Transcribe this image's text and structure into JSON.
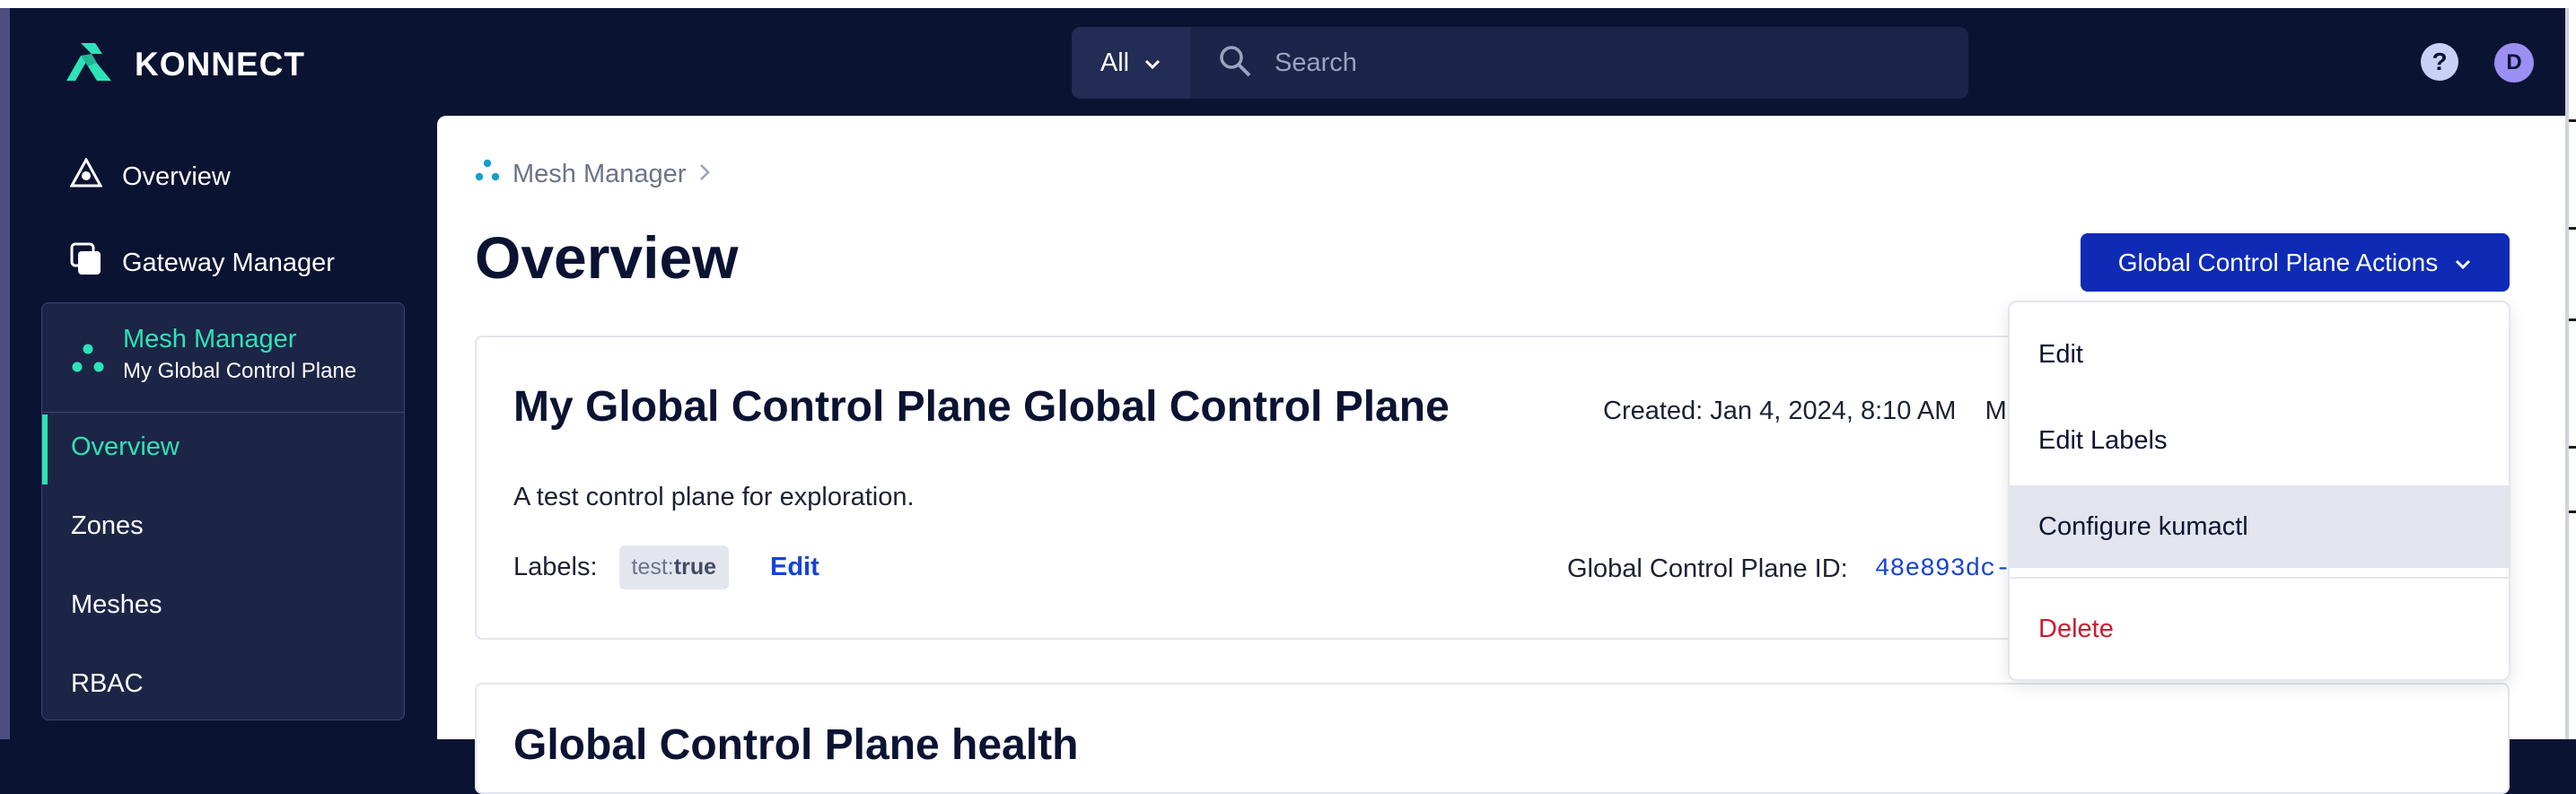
{
  "brand": {
    "name": "KONNECT"
  },
  "header": {
    "search_filter": "All",
    "search_placeholder": "Search",
    "help_label": "?",
    "avatar_initial": "D"
  },
  "sidebar": {
    "items": [
      {
        "label": "Overview",
        "icon": "overview-triangle-icon"
      },
      {
        "label": "Gateway Manager",
        "icon": "gateway-stack-icon"
      }
    ],
    "mesh_manager": {
      "title": "Mesh Manager",
      "subtitle": "My Global Control Plane",
      "icon": "mesh-dots-icon",
      "sub_items": [
        "Overview",
        "Zones",
        "Meshes",
        "RBAC"
      ],
      "active_sub_item": "Overview"
    }
  },
  "main": {
    "breadcrumb": "Mesh Manager",
    "page_title": "Overview",
    "actions_button": "Global Control Plane Actions",
    "card": {
      "title": "My Global Control Plane Global Control Plane",
      "created": "Created: Jan 4, 2024, 8:10 AM",
      "created_trail": "M",
      "description": "A test control plane for exploration.",
      "labels_label": "Labels:",
      "tag_key": "test:",
      "tag_value": "true",
      "edit_label": "Edit",
      "id_label": "Global Control Plane ID:",
      "id_value": "48e893dc-"
    },
    "second_card_title": "Global Control Plane health"
  },
  "dropdown": {
    "items": [
      "Edit",
      "Edit Labels",
      "Configure kumactl"
    ],
    "highlighted": "Configure kumactl",
    "danger_item": "Delete"
  },
  "colors": {
    "nav_bg": "#0b1333",
    "accent_teal": "#2ee3b7",
    "primary_button": "#0f2bb6",
    "link_blue": "#1543d6",
    "danger_red": "#cc1c2c"
  }
}
